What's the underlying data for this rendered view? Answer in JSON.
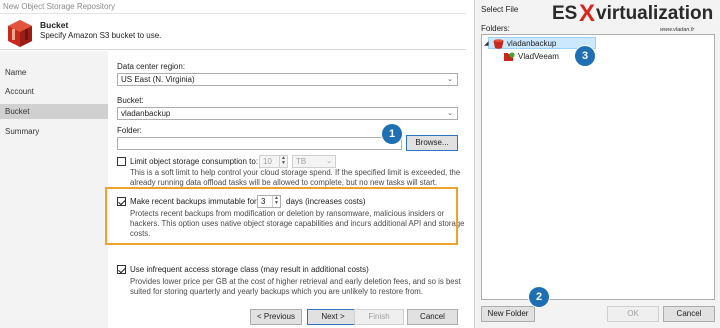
{
  "wizard": {
    "window_title": "New Object Storage Repository",
    "heading": "Bucket",
    "subheading": "Specify Amazon S3 bucket to use.",
    "nav": [
      {
        "label": "Name",
        "active": false
      },
      {
        "label": "Account",
        "active": false
      },
      {
        "label": "Bucket",
        "active": true
      },
      {
        "label": "Summary",
        "active": false
      }
    ],
    "region": {
      "label": "Data center region:",
      "value": "US East (N. Virginia)"
    },
    "bucket": {
      "label": "Bucket:",
      "value": "vladanbackup"
    },
    "folder": {
      "label": "Folder:",
      "value": "",
      "browse_label": "Browse..."
    },
    "limit": {
      "label": "Limit object storage consumption to:",
      "checked": false,
      "value": "10",
      "unit": "TB",
      "description": [
        "This is a soft limit to help control your cloud storage spend. If the specified limit is exceeded, the",
        "already running data offload tasks will be allowed to complete, but no new tasks will start."
      ]
    },
    "immutable": {
      "label": "Make recent backups immutable for:",
      "checked": true,
      "value": "3",
      "suffix": "days (increases costs)",
      "description": [
        "Protects recent backups from modification or deletion by ransomware, malicious insiders or",
        "hackers. This option uses native object storage capabilities and incurs additional API and storage",
        "costs."
      ]
    },
    "infrequent": {
      "label": "Use infrequent access storage class (may result in additional costs)",
      "checked": true,
      "description": [
        "Provides lower price per GB at the cost of higher retrieval and early deletion fees, and so is best",
        "suited for storing quarterly and yearly backups which you are unlikely to restore from."
      ]
    },
    "buttons": {
      "previous": "< Previous",
      "next": "Next >",
      "finish": "Finish",
      "cancel": "Cancel"
    }
  },
  "select_file": {
    "title": "Select File",
    "folders_label": "Folders:",
    "tree": [
      {
        "label": "vladanbackup",
        "level": 0,
        "expanded": true,
        "selected": true,
        "icon": "bucket-icon"
      },
      {
        "label": "VladVeeam",
        "level": 1,
        "expanded": false,
        "selected": false,
        "icon": "veeam-folder-icon"
      }
    ],
    "buttons": {
      "new_folder": "New Folder",
      "ok": "OK",
      "cancel": "Cancel"
    }
  },
  "callouts": [
    "1",
    "2",
    "3"
  ],
  "watermark": {
    "brand_prefix": "ES",
    "brand_x": "X",
    "brand_suffix": "virtualization",
    "url": "www.vladan.fr"
  },
  "colors": {
    "accent_blue": "#1f6fb5",
    "highlight_orange": "#f0a32a",
    "brand_red": "#d9261c",
    "selection": "#cce8ff"
  }
}
